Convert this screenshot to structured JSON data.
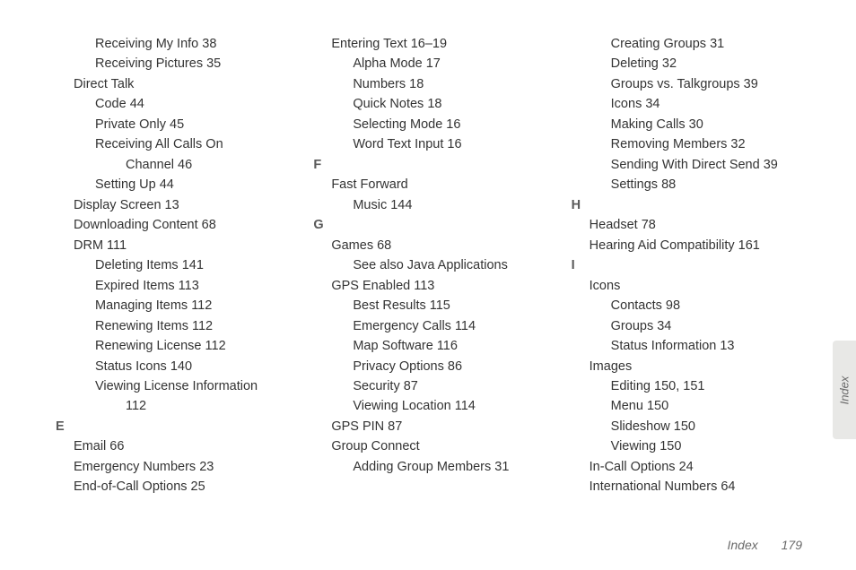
{
  "tab_label": "Index",
  "footer_section": "Index",
  "footer_page": "179",
  "col1": [
    {
      "cls": "lvl2",
      "t": "Receiving My Info 38"
    },
    {
      "cls": "lvl2",
      "t": "Receiving Pictures 35"
    },
    {
      "cls": "lvl1",
      "t": "Direct Talk"
    },
    {
      "cls": "lvl2",
      "t": "Code 44"
    },
    {
      "cls": "lvl2",
      "t": "Private Only 45"
    },
    {
      "cls": "lvl2",
      "t": "Receiving All Calls On"
    },
    {
      "cls": "lvl3-cont",
      "t": "Channel 46"
    },
    {
      "cls": "lvl2",
      "t": "Setting Up 44"
    },
    {
      "cls": "lvl1",
      "t": "Display Screen 13"
    },
    {
      "cls": "lvl1",
      "t": "Downloading Content 68"
    },
    {
      "cls": "lvl1",
      "t": "DRM 111"
    },
    {
      "cls": "lvl2",
      "t": "Deleting Items 141"
    },
    {
      "cls": "lvl2",
      "t": "Expired Items 113"
    },
    {
      "cls": "lvl2",
      "t": "Managing Items 112"
    },
    {
      "cls": "lvl2",
      "t": "Renewing Items 112"
    },
    {
      "cls": "lvl2",
      "t": "Renewing License 112"
    },
    {
      "cls": "lvl2",
      "t": "Status Icons 140"
    },
    {
      "cls": "lvl2",
      "t": "Viewing License Information"
    },
    {
      "cls": "lvl3-cont",
      "t": "112"
    },
    {
      "cls": "letter",
      "t": "E"
    },
    {
      "cls": "lvl1",
      "t": "Email 66"
    },
    {
      "cls": "lvl1",
      "t": "Emergency Numbers 23"
    },
    {
      "cls": "lvl1",
      "t": "End-of-Call Options 25"
    }
  ],
  "col2": [
    {
      "cls": "lvl1",
      "t": "Entering Text 16–19"
    },
    {
      "cls": "lvl2",
      "t": "Alpha Mode 17"
    },
    {
      "cls": "lvl2",
      "t": "Numbers 18"
    },
    {
      "cls": "lvl2",
      "t": "Quick Notes 18"
    },
    {
      "cls": "lvl2",
      "t": "Selecting Mode 16"
    },
    {
      "cls": "lvl2",
      "t": "Word Text Input 16"
    },
    {
      "cls": "letter",
      "t": "F"
    },
    {
      "cls": "lvl1",
      "t": "Fast Forward"
    },
    {
      "cls": "lvl2",
      "t": "Music 144"
    },
    {
      "cls": "letter",
      "t": "G"
    },
    {
      "cls": "lvl1",
      "t": "Games 68"
    },
    {
      "cls": "lvl2",
      "t": "See also Java Applications"
    },
    {
      "cls": "lvl1",
      "t": "GPS Enabled 113"
    },
    {
      "cls": "lvl2",
      "t": "Best Results 115"
    },
    {
      "cls": "lvl2",
      "t": "Emergency Calls 114"
    },
    {
      "cls": "lvl2",
      "t": "Map Software 116"
    },
    {
      "cls": "lvl2",
      "t": "Privacy Options 86"
    },
    {
      "cls": "lvl2",
      "t": "Security 87"
    },
    {
      "cls": "lvl2",
      "t": "Viewing Location 114"
    },
    {
      "cls": "lvl1",
      "t": "GPS PIN 87"
    },
    {
      "cls": "lvl1",
      "t": "Group Connect"
    },
    {
      "cls": "lvl2",
      "t": "Adding Group Members 31"
    }
  ],
  "col3": [
    {
      "cls": "lvl2",
      "t": "Creating Groups 31"
    },
    {
      "cls": "lvl2",
      "t": "Deleting 32"
    },
    {
      "cls": "lvl2",
      "t": "Groups vs. Talkgroups 39"
    },
    {
      "cls": "lvl2",
      "t": "Icons 34"
    },
    {
      "cls": "lvl2",
      "t": "Making Calls 30"
    },
    {
      "cls": "lvl2",
      "t": "Removing Members 32"
    },
    {
      "cls": "lvl2",
      "t": "Sending With Direct Send 39"
    },
    {
      "cls": "lvl2",
      "t": "Settings 88"
    },
    {
      "cls": "letter",
      "t": "H"
    },
    {
      "cls": "lvl1",
      "t": "Headset 78"
    },
    {
      "cls": "lvl1",
      "t": "Hearing Aid Compatibility 161"
    },
    {
      "cls": "letter",
      "t": "I"
    },
    {
      "cls": "lvl1",
      "t": "Icons"
    },
    {
      "cls": "lvl2",
      "t": "Contacts 98"
    },
    {
      "cls": "lvl2",
      "t": "Groups 34"
    },
    {
      "cls": "lvl2",
      "t": "Status Information 13"
    },
    {
      "cls": "lvl1",
      "t": "Images"
    },
    {
      "cls": "lvl2",
      "t": "Editing 150, 151"
    },
    {
      "cls": "lvl2",
      "t": "Menu 150"
    },
    {
      "cls": "lvl2",
      "t": "Slideshow 150"
    },
    {
      "cls": "lvl2",
      "t": "Viewing 150"
    },
    {
      "cls": "lvl1",
      "t": "In-Call Options 24"
    },
    {
      "cls": "lvl1",
      "t": "International Numbers 64"
    }
  ]
}
